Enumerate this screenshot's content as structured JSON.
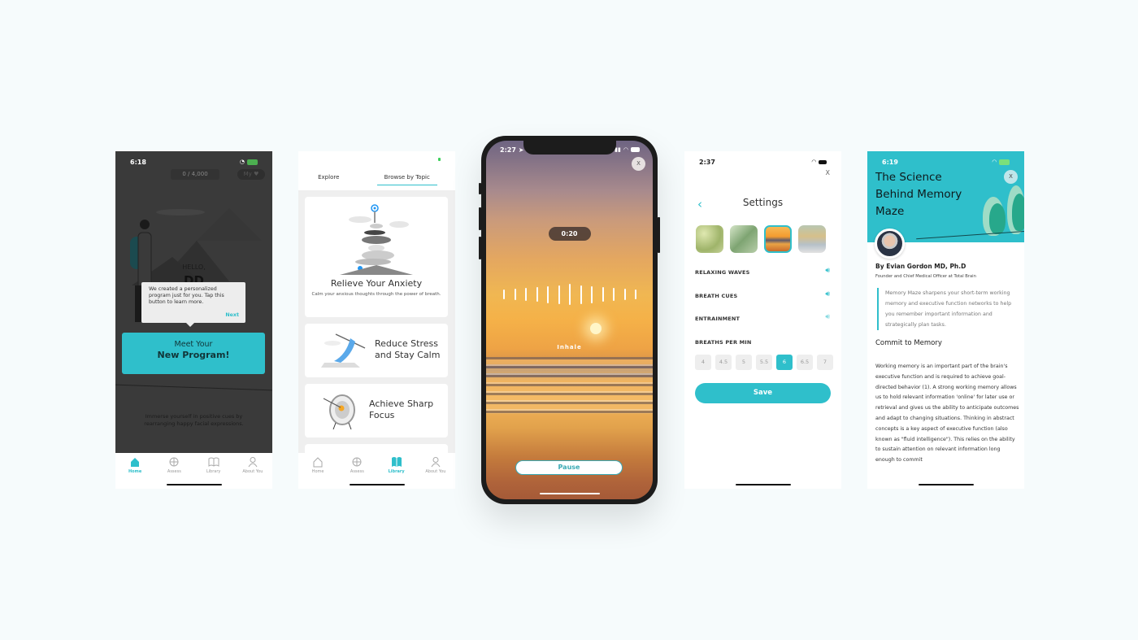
{
  "screens": {
    "home": {
      "status_time": "6:18",
      "points": "0 / 4,000",
      "my_badge": "My",
      "greeting": "HELLO,",
      "initials": "DD",
      "tooltip": {
        "text": "We created a personalized program just for you. Tap this button to learn more.",
        "next_label": "Next"
      },
      "cta": {
        "line1": "Meet Your",
        "line2": "New Program!"
      },
      "description": "Immerse yourself in positive cues by rearranging happy facial expressions."
    },
    "library": {
      "tabs": [
        {
          "label": "Explore",
          "active": false
        },
        {
          "label": "Browse by Topic",
          "active": true
        }
      ],
      "cards": [
        {
          "title": "Relieve Your Anxiety",
          "subtitle": "Calm your anxious thoughts through the power of breath."
        },
        {
          "title": "Reduce Stress and Stay Calm"
        },
        {
          "title": "Achieve Sharp Focus"
        }
      ]
    },
    "player": {
      "status_time": "2:27",
      "close_label": "X",
      "timer": "0:20",
      "phase": "Inhale",
      "pause_label": "Pause",
      "breath_bar_levels": [
        0.45,
        0.55,
        0.6,
        0.7,
        0.8,
        0.9,
        1.0,
        0.9,
        0.8,
        0.7,
        0.6,
        0.55,
        0.45
      ]
    },
    "settings": {
      "status_time": "2:37",
      "close_label": "X",
      "title": "Settings",
      "backgrounds": [
        {
          "name": "leaves",
          "selected": false
        },
        {
          "name": "fern",
          "selected": false
        },
        {
          "name": "sunset-beach",
          "selected": true
        },
        {
          "name": "river",
          "selected": false
        }
      ],
      "sounds": [
        {
          "label": "RELAXING WAVES",
          "on": true
        },
        {
          "label": "BREATH CUES",
          "on": true
        },
        {
          "label": "ENTRAINMENT",
          "on": false
        }
      ],
      "bpm_label": "BREATHS PER MIN",
      "bpm_options": [
        "4",
        "4.5",
        "5",
        "5.5",
        "6",
        "6.5",
        "7"
      ],
      "bpm_selected": "6",
      "save_label": "Save"
    },
    "article": {
      "status_time": "6:19",
      "title": "The Science Behind Memory Maze",
      "close_label": "X",
      "author": "By Evian Gordon MD, Ph.D",
      "role": "Founder and Chief Medical Officer at Total Brain",
      "quote": "Memory Maze sharpens your short-term working memory and executive function networks to help you remember important information and strategically plan tasks.",
      "section_title": "Commit to Memory",
      "body": "Working memory is an important part of the brain's executive function and is required to achieve goal-directed behavior (1). A strong working memory allows us to hold relevant information 'online' for later use or retrieval and gives us the ability to anticipate outcomes and adapt to changing situations. Thinking in abstract concepts is a key aspect of executive function (also known as \"fluid intelligence\"). This relies on the ability to sustain attention on relevant information long enough to commit"
    }
  },
  "tabbar": [
    {
      "label": "Home",
      "icon": "home-icon"
    },
    {
      "label": "Assess",
      "icon": "assess-icon"
    },
    {
      "label": "Library",
      "icon": "library-icon"
    },
    {
      "label": "About You",
      "icon": "profile-icon"
    }
  ],
  "colors": {
    "accent": "#2fbfcb",
    "background": "#f6fbfc",
    "dark_overlay": "#3a3a3a"
  }
}
